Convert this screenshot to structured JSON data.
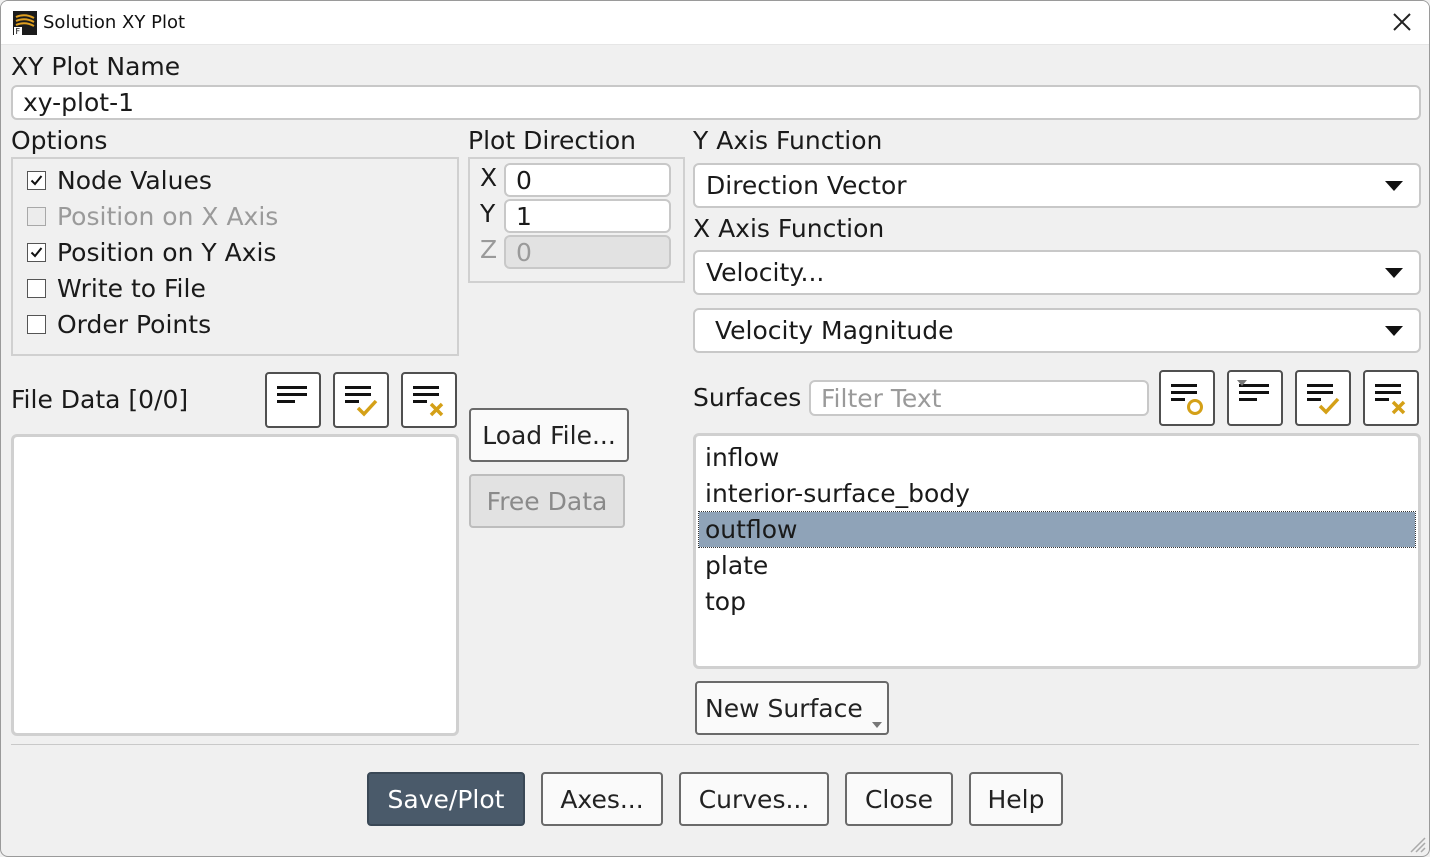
{
  "window": {
    "title": "Solution XY Plot",
    "close_symbol": "✕"
  },
  "plot_name": {
    "label": "XY Plot Name",
    "value": "xy-plot-1"
  },
  "options": {
    "label": "Options",
    "items": [
      {
        "label": "Node Values",
        "checked": true,
        "enabled": true
      },
      {
        "label": "Position on X Axis",
        "checked": false,
        "enabled": false
      },
      {
        "label": "Position on Y Axis",
        "checked": true,
        "enabled": true
      },
      {
        "label": "Write to File",
        "checked": false,
        "enabled": true
      },
      {
        "label": "Order Points",
        "checked": false,
        "enabled": true
      }
    ]
  },
  "plot_direction": {
    "label": "Plot Direction",
    "x": {
      "label": "X",
      "value": "0"
    },
    "y": {
      "label": "Y",
      "value": "1"
    },
    "z": {
      "label": "Z",
      "value": "0"
    }
  },
  "y_axis_function": {
    "label": "Y Axis Function",
    "value": "Direction Vector"
  },
  "x_axis_function": {
    "label": "X Axis Function",
    "category": "Velocity...",
    "quantity": "Velocity Magnitude"
  },
  "file_data": {
    "label": "File Data [0/0]",
    "items": []
  },
  "file_buttons": {
    "load": "Load File...",
    "free": "Free Data"
  },
  "surfaces": {
    "label": "Surfaces",
    "filter_placeholder": "Filter Text",
    "items": [
      "inflow",
      "interior-surface_body",
      "outflow",
      "plate",
      "top"
    ],
    "selected_index": 2,
    "new_surface": "New Surface"
  },
  "footer": {
    "save_plot": "Save/Plot",
    "axes": "Axes...",
    "curves": "Curves...",
    "close": "Close",
    "help": "Help"
  },
  "colors": {
    "accent_dark": "#4a5a6a",
    "selection": "#8fa3b8",
    "icon_gold": "#d4a017"
  }
}
